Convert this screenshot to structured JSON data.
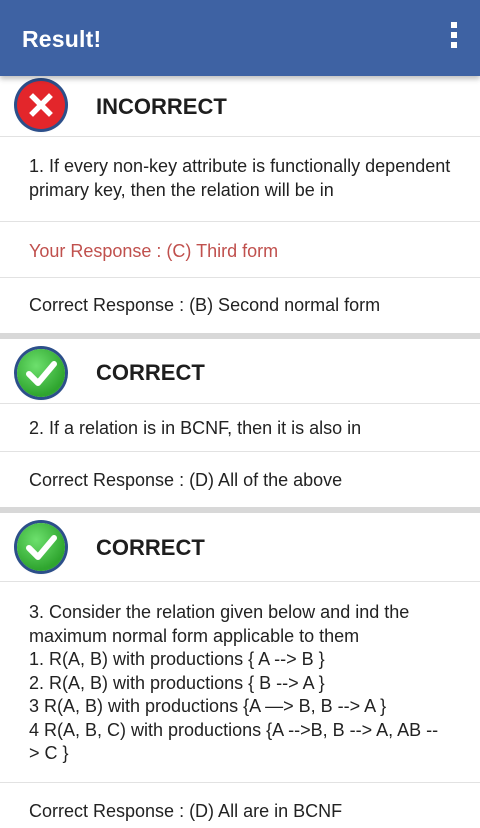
{
  "appbar": {
    "title": "Result!"
  },
  "cards": [
    {
      "status": "INCORRECT",
      "badge_icon": "cross-icon",
      "question": "1. If every non-key attribute is functionally dependent primary key, then the relation will be in",
      "your_response": "Your Response : (C) Third form",
      "correct_response": "Correct Response : (B) Second normal form"
    },
    {
      "status": "CORRECT",
      "badge_icon": "check-icon",
      "question": "2. If a relation is in BCNF, then it is also in",
      "correct_response": "Correct Response : (D) All of the above"
    },
    {
      "status": "CORRECT",
      "badge_icon": "check-icon",
      "question_lines": [
        "3. Consider the relation given below and ind the maximum normal form applicable to them",
        "1. R(A, B) with productions { A --> B }",
        "2. R(A, B) with productions { B --> A }",
        "3 R(A, B) with productions {A —> B, B --> A }",
        "4 R(A, B, C) with productions {A -->B, B --> A, AB -- > C }"
      ],
      "correct_response": "Correct Response : (D) All are in BCNF"
    }
  ],
  "colors": {
    "appbar": "#3e62a3",
    "incorrect_badge": "#e3262b",
    "correct_badge": "#3bb53b",
    "your_response_text": "#c0504d"
  }
}
